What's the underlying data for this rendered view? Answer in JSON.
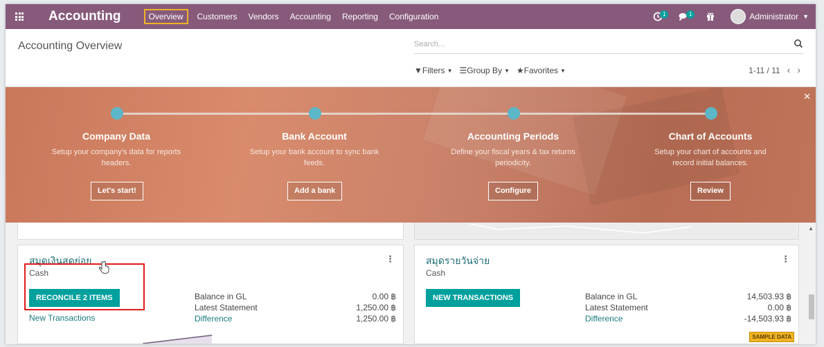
{
  "navbar": {
    "brand": "Accounting",
    "menu": [
      {
        "label": "Overview",
        "active": true
      },
      {
        "label": "Customers"
      },
      {
        "label": "Vendors"
      },
      {
        "label": "Accounting"
      },
      {
        "label": "Reporting"
      },
      {
        "label": "Configuration"
      }
    ],
    "activity_count": "1",
    "messages_count": "1",
    "user": "Administrator",
    "accent_color": "#875a7b"
  },
  "control": {
    "title": "Accounting Overview",
    "search_placeholder": "Search...",
    "filters": "Filters",
    "group_by": "Group By",
    "favorites": "Favorites",
    "pager": "1-11 / 11"
  },
  "banner": {
    "steps": [
      {
        "title": "Company Data",
        "desc": "Setup your company's data for reports headers.",
        "button": "Let's start!"
      },
      {
        "title": "Bank Account",
        "desc": "Setup your bank account to sync bank feeds.",
        "button": "Add a bank"
      },
      {
        "title": "Accounting Periods",
        "desc": "Define your fiscal years & tax returns periodicity.",
        "button": "Configure"
      },
      {
        "title": "Chart of Accounts",
        "desc": "Setup your chart of accounts and record initial balances.",
        "button": "Review"
      }
    ]
  },
  "cards": [
    {
      "title": "สมุดเงินสดย่อย",
      "subtitle": "Cash",
      "button": "RECONCILE 2 ITEMS",
      "link": "New Transactions",
      "labels": [
        "Balance in GL",
        "Latest Statement",
        "Difference"
      ],
      "values": [
        "0.00 ฿",
        "1,250.00 ฿",
        "1,250.00 ฿"
      ]
    },
    {
      "title": "สมุดรายวันจ่าย",
      "subtitle": "Cash",
      "button": "NEW TRANSACTIONS",
      "labels": [
        "Balance in GL",
        "Latest Statement",
        "Difference"
      ],
      "values": [
        "14,503.93 ฿",
        "0.00 ฿",
        "-14,503.93 ฿"
      ],
      "badge": "SAMPLE DATA"
    }
  ]
}
